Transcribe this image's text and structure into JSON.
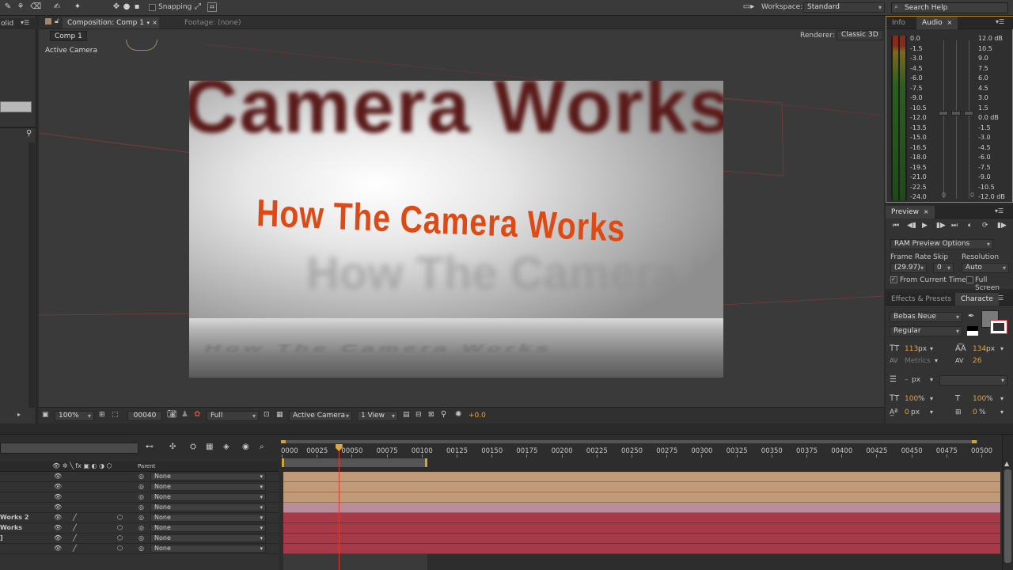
{
  "toolbar": {
    "snapping_label": "Snapping",
    "workspace_label": "Workspace:",
    "workspace_value": "Standard",
    "search_placeholder": "Search Help"
  },
  "comp_panel": {
    "tab_composition": "Composition: Comp 1",
    "tab_footage": "Footage: (none)",
    "comp_name_tab": "Comp 1",
    "renderer_label": "Renderer:",
    "renderer_value": "Classic 3D",
    "view_label": "Active Camera",
    "title_main": "How The Camera Works",
    "title_top_blur": "Camera Works",
    "title_reflection": "How The Camera Works",
    "viewer_controls": {
      "zoom": "100%",
      "timecode": "00040",
      "resolution": "Full",
      "camera": "Active Camera",
      "views": "1 View",
      "exposure": "+0.0"
    }
  },
  "left_panel": {
    "partial_label": "olid"
  },
  "audio": {
    "tab_info": "Info",
    "tab_audio": "Audio",
    "left_scale": [
      "0.0",
      "-1.5",
      "-3.0",
      "-4.5",
      "-6.0",
      "-7.5",
      "-9.0",
      "-10.5",
      "-12.0",
      "-13.5",
      "-15.0",
      "-16.5",
      "-18.0",
      "-19.5",
      "-21.0",
      "-22.5",
      "-24.0"
    ],
    "right_scale": [
      "12.0 dB",
      "10.5",
      "9.0",
      "7.5",
      "6.0",
      "4.5",
      "3.0",
      "1.5",
      "0.0 dB",
      "-1.5",
      "-3.0",
      "-4.5",
      "-6.0",
      "-7.5",
      "-9.0",
      "-10.5",
      "-12.0 dB"
    ],
    "slider_zero_left": "0",
    "slider_zero_right": "0"
  },
  "preview": {
    "tab_label": "Preview",
    "ram_options": "RAM Preview Options",
    "frame_rate_label": "Frame Rate",
    "skip_label": "Skip",
    "resolution_label": "Resolution",
    "frame_rate_value": "(29.97)",
    "skip_value": "0",
    "resolution_value": "Auto",
    "from_current_time": "From Current Time",
    "full_screen": "Full Screen"
  },
  "character": {
    "tab_effects": "Effects & Presets",
    "tab_character": "Characte",
    "font_family": "Bebas Neue",
    "font_style": "Regular",
    "font_size": "113",
    "font_size_unit": "px",
    "leading": "134",
    "leading_unit": "px",
    "kerning": "Metrics",
    "tracking": "26",
    "stroke_width": "–",
    "stroke_unit": "px",
    "vert_scale": "100",
    "horiz_scale": "100",
    "baseline_shift": "0",
    "baseline_unit": "px",
    "tsume": "0",
    "pct": "%",
    "fill_color": "#7a7a7a"
  },
  "timeline": {
    "parent_header": "Parent",
    "ruler_labels": [
      "0000",
      "00025",
      "00050",
      "00075",
      "00100",
      "00125",
      "00150",
      "00175",
      "00200",
      "00225",
      "00250",
      "00275",
      "00300",
      "00325",
      "00350",
      "00375",
      "00400",
      "00425",
      "00450",
      "00475",
      "00500"
    ],
    "current_frame": 40,
    "layers": [
      {
        "name": "",
        "parent": "None",
        "color": "#c19b78"
      },
      {
        "name": "",
        "parent": "None",
        "color": "#c19b78"
      },
      {
        "name": "",
        "parent": "None",
        "color": "#c19b78"
      },
      {
        "name": "",
        "parent": "None",
        "color": "#b98e9a"
      },
      {
        "name": "Works 2",
        "parent": "None",
        "color": "#a73a48"
      },
      {
        "name": "Works",
        "parent": "None",
        "color": "#a73a48"
      },
      {
        "name": "]",
        "parent": "None",
        "color": "#a73a48"
      },
      {
        "name": "",
        "parent": "None",
        "color": "#a73a48"
      }
    ]
  }
}
